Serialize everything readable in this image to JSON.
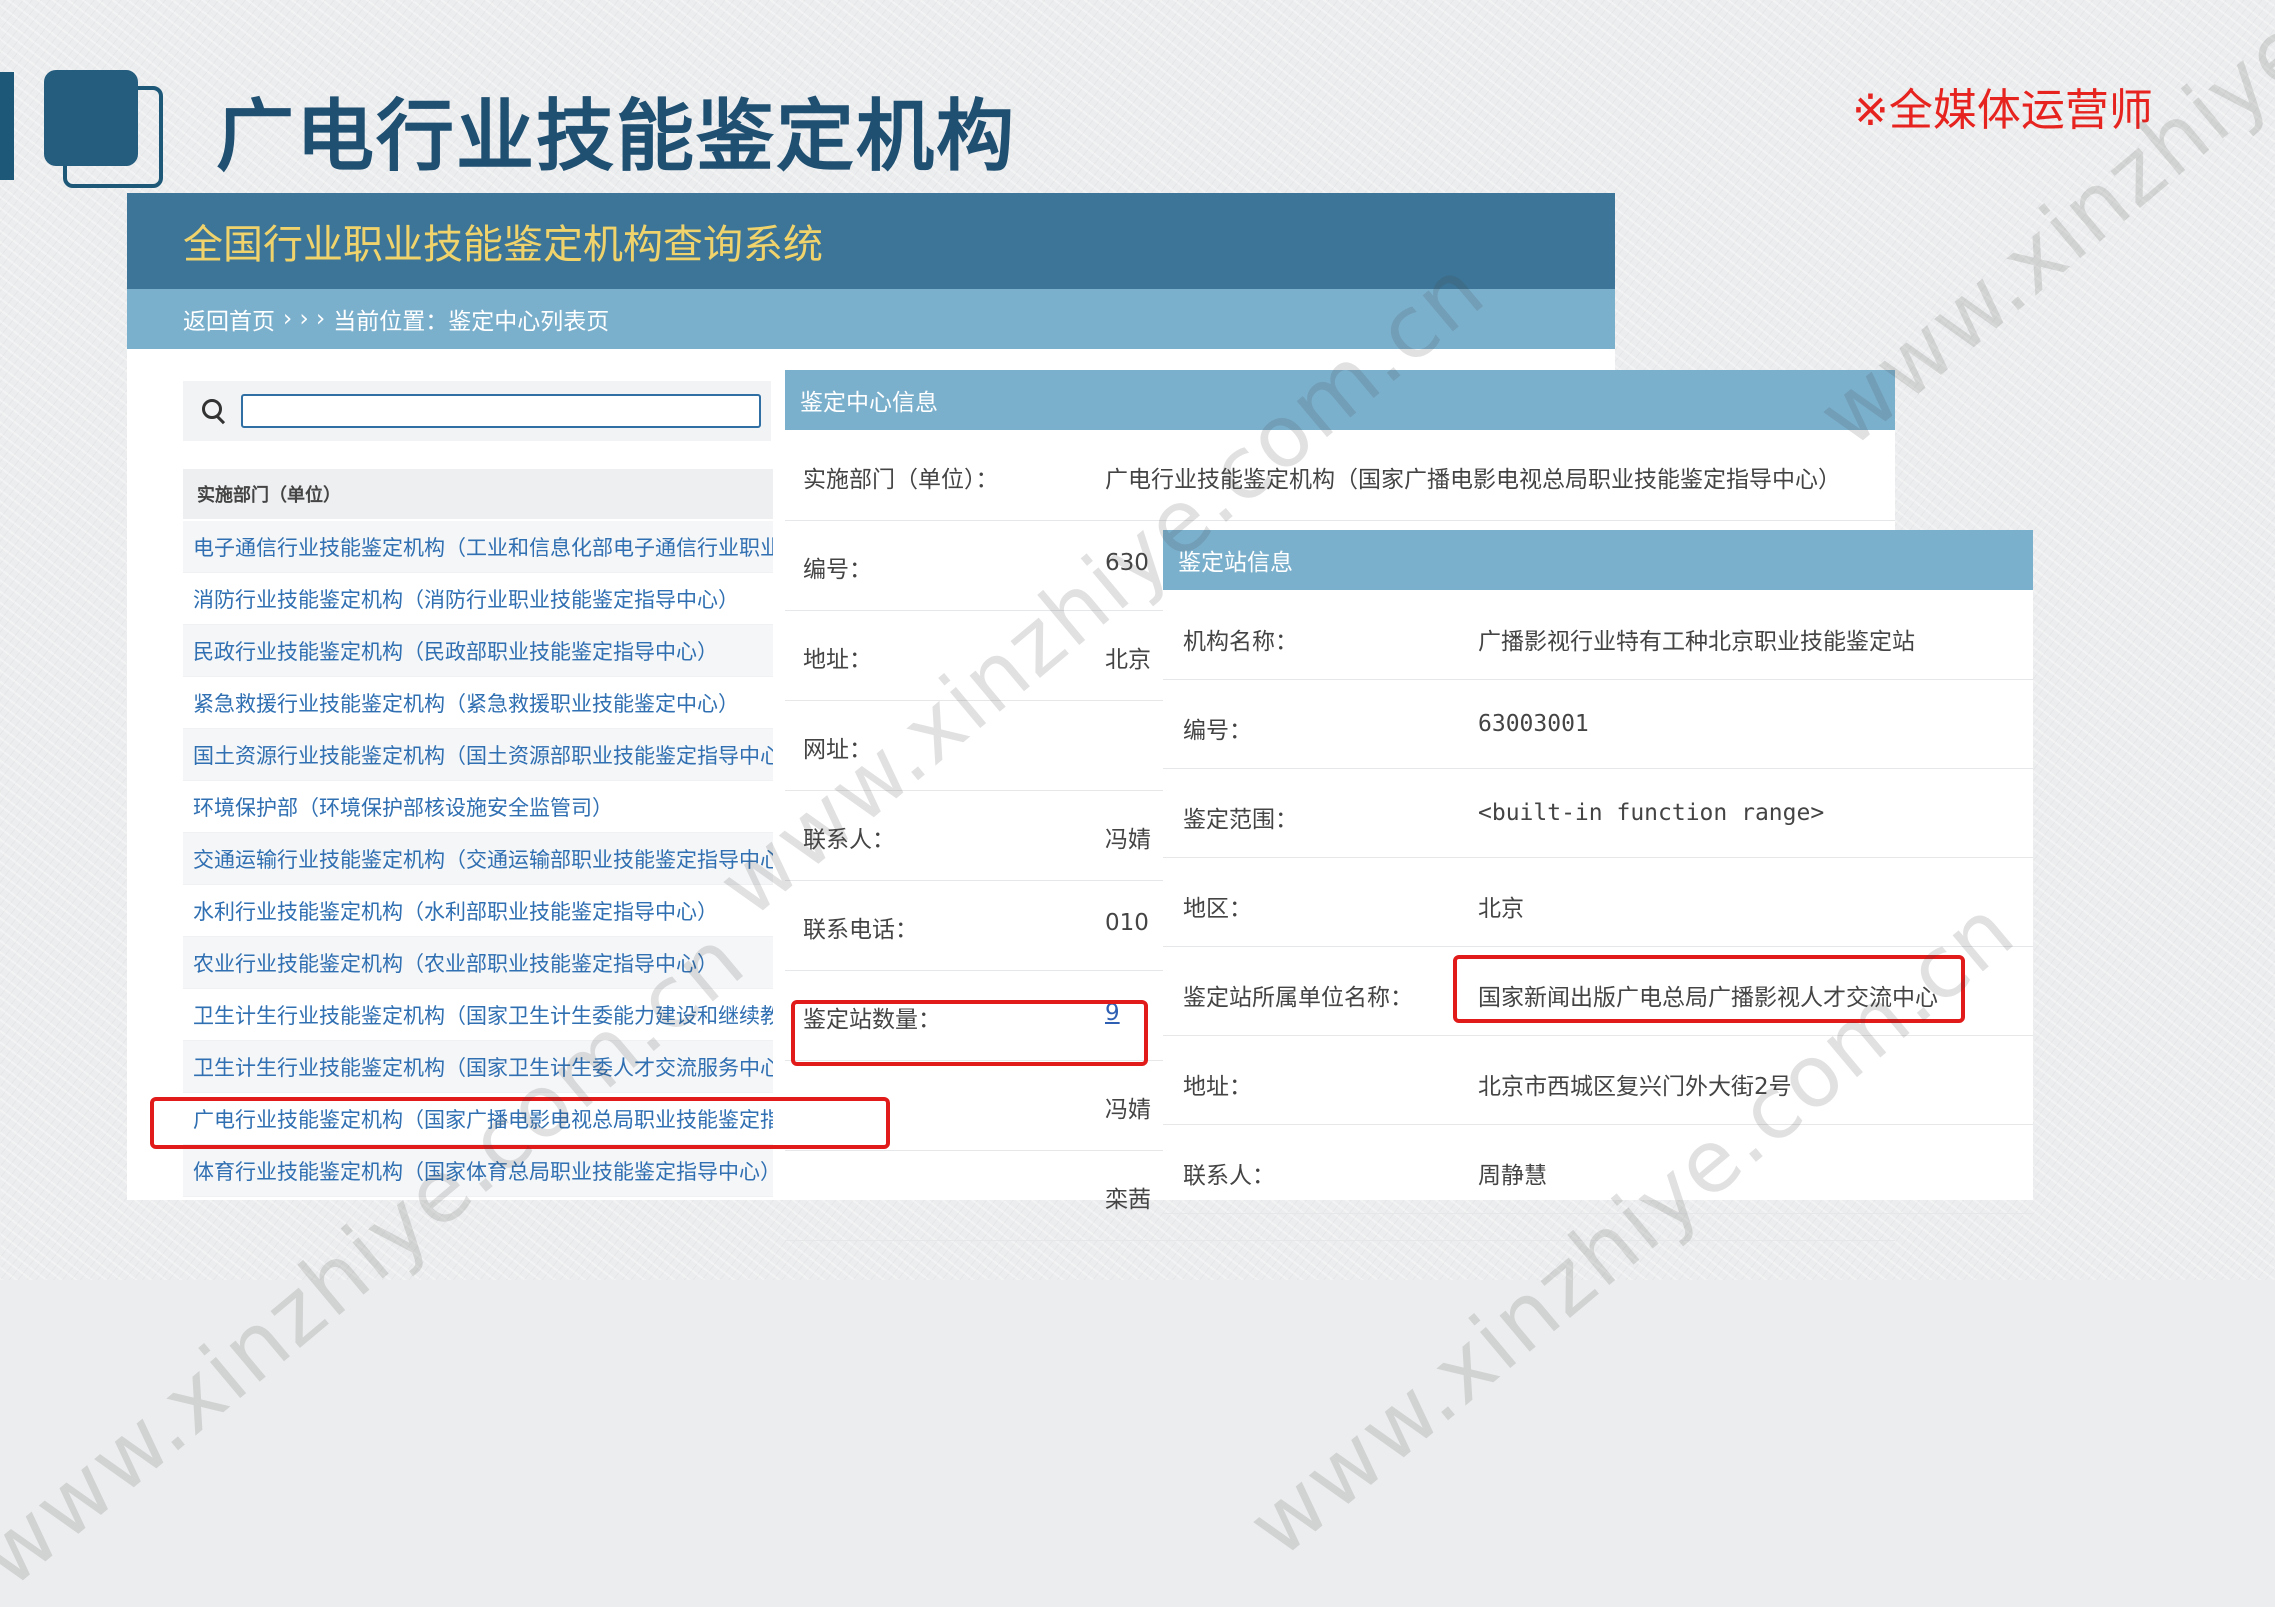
{
  "slide": {
    "title": "广电行业技能鉴定机构",
    "tag": "※全媒体运营师"
  },
  "system": {
    "title": "全国行业职业技能鉴定机构查询系统",
    "breadcrumb_home": "返回首页",
    "breadcrumb_sep": "› › ›",
    "breadcrumb_current": "当前位置：鉴定中心列表页",
    "search_value": "",
    "list_header": "实施部门（单位）",
    "items": [
      "电子通信行业技能鉴定机构（工业和信息化部电子通信行业职业",
      "消防行业技能鉴定机构（消防行业职业技能鉴定指导中心）",
      "民政行业技能鉴定机构（民政部职业技能鉴定指导中心）",
      "紧急救援行业技能鉴定机构（紧急救援职业技能鉴定中心）",
      "国土资源行业技能鉴定机构（国土资源部职业技能鉴定指导中心",
      "环境保护部（环境保护部核设施安全监管司）",
      "交通运输行业技能鉴定机构（交通运输部职业技能鉴定指导中心",
      "水利行业技能鉴定机构（水利部职业技能鉴定指导中心）",
      "农业行业技能鉴定机构（农业部职业技能鉴定指导中心）",
      "卫生计生行业技能鉴定机构（国家卫生计生委能力建设和继续教",
      "卫生计生行业技能鉴定机构（国家卫生计生委人才交流服务中心",
      "广电行业技能鉴定机构（国家广播电影电视总局职业技能鉴定指导中心）",
      "体育行业技能鉴定机构（国家体育总局职业技能鉴定指导中心）"
    ]
  },
  "center": {
    "title": "鉴定中心信息",
    "rows": [
      {
        "label": "实施部门（单位）：",
        "value": "广电行业技能鉴定机构（国家广播电影电视总局职业技能鉴定指导中心）"
      },
      {
        "label": "编号：",
        "value": "630"
      },
      {
        "label": "地址：",
        "value": "北京"
      },
      {
        "label": "网址：",
        "value": ""
      },
      {
        "label": "联系人：",
        "value": "冯婧"
      },
      {
        "label": "联系电话：",
        "value": "010"
      },
      {
        "label": "鉴定站数量：",
        "value": "9"
      },
      {
        "label": "",
        "value": "冯婧"
      },
      {
        "label": "",
        "value": "栾茜"
      }
    ]
  },
  "station": {
    "title": "鉴定站信息",
    "rows": [
      {
        "label": "机构名称：",
        "value": "广播影视行业特有工种北京职业技能鉴定站"
      },
      {
        "label": "编号：",
        "value": "63003001"
      },
      {
        "label": "鉴定范围：",
        "value": "<built-in function range>"
      },
      {
        "label": "地区：",
        "value": "北京"
      },
      {
        "label": "鉴定站所属单位名称：",
        "value": "国家新闻出版广电总局广播影视人才交流中心"
      },
      {
        "label": "地址：",
        "value": "北京市西城区复兴门外大街2号"
      },
      {
        "label": "联系人：",
        "value": "周静慧"
      }
    ]
  },
  "watermark": "www.xinzhiye.com.cn",
  "colors": {
    "title_blue": "#1f4f71",
    "header_dark": "#3c7597",
    "header_light": "#7bb0cd",
    "system_title_yellow": "#f1d36c",
    "link_blue": "#2f6fb2",
    "highlight_red": "#e11a1a",
    "tag_red": "#e6231f"
  }
}
